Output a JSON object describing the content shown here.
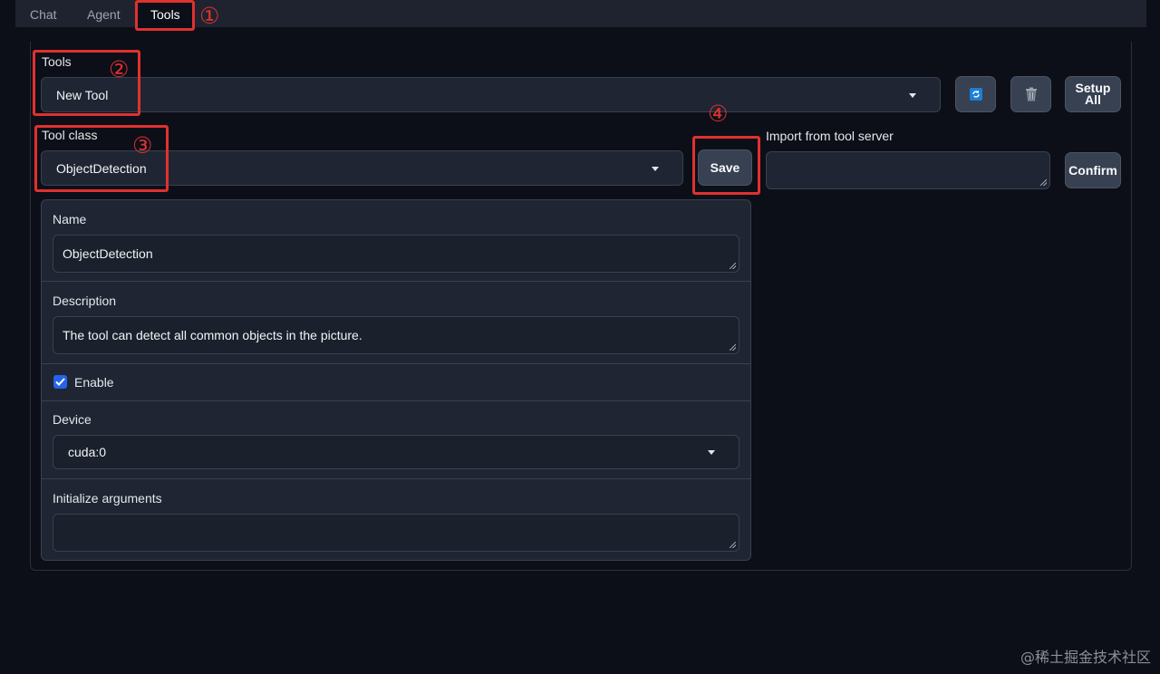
{
  "tabs": [
    {
      "label": "Chat"
    },
    {
      "label": "Agent"
    },
    {
      "label": "Tools"
    }
  ],
  "annotations": [
    "①",
    "②",
    "③",
    "④"
  ],
  "tools": {
    "label": "Tools",
    "selected": "New Tool",
    "refresh_icon": "refresh-icon",
    "delete_icon": "trash-icon",
    "setup_all_line1": "Setup",
    "setup_all_line2": "All"
  },
  "tool_class": {
    "label": "Tool class",
    "selected": "ObjectDetection",
    "save_label": "Save"
  },
  "import": {
    "label": "Import from tool server",
    "value": "",
    "confirm_label": "Confirm"
  },
  "form": {
    "name_label": "Name",
    "name_value": "ObjectDetection",
    "description_label": "Description",
    "description_value": "The tool can detect all common objects in the picture.",
    "enable_label": "Enable",
    "enable_checked": true,
    "device_label": "Device",
    "device_value": "cuda:0",
    "init_args_label": "Initialize arguments",
    "init_args_value": ""
  },
  "watermark": "@稀土掘金技术社区",
  "colors": {
    "accent_blue": "#2563eb",
    "annotation_red": "#e0312f",
    "background": "#0c0f17"
  }
}
